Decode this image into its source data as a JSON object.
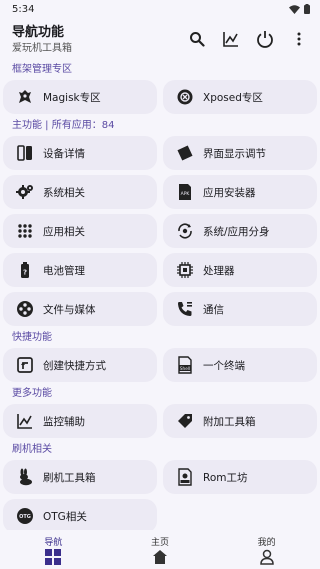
{
  "status": {
    "time": "5:34"
  },
  "app": {
    "title": "导航功能",
    "subtitle": "爱玩机工具箱"
  },
  "sections": [
    {
      "title": "框架管理专区",
      "items": [
        {
          "label": "Magisk专区",
          "icon": "magisk-icon"
        },
        {
          "label": "Xposed专区",
          "icon": "xposed-icon"
        }
      ]
    },
    {
      "title": "主功能 | 所有应用：84",
      "items": [
        {
          "label": "设备详情",
          "icon": "device-icon"
        },
        {
          "label": "界面显示调节",
          "icon": "display-icon"
        },
        {
          "label": "系统相关",
          "icon": "gear-icon"
        },
        {
          "label": "应用安装器",
          "icon": "apk-icon"
        },
        {
          "label": "应用相关",
          "icon": "apps-grid-icon"
        },
        {
          "label": "系统/应用分身",
          "icon": "clone-icon"
        },
        {
          "label": "电池管理",
          "icon": "battery-icon"
        },
        {
          "label": "处理器",
          "icon": "cpu-icon"
        },
        {
          "label": "文件与媒体",
          "icon": "media-icon"
        },
        {
          "label": "通信",
          "icon": "phone-icon"
        }
      ]
    },
    {
      "title": "快捷功能",
      "items": [
        {
          "label": "创建快捷方式",
          "icon": "shortcut-icon"
        },
        {
          "label": "一个终端",
          "icon": "shell-icon"
        }
      ]
    },
    {
      "title": "更多功能",
      "items": [
        {
          "label": "监控辅助",
          "icon": "monitor-icon"
        },
        {
          "label": "附加工具箱",
          "icon": "tag-icon"
        }
      ]
    },
    {
      "title": "刷机相关",
      "items": [
        {
          "label": "刷机工具箱",
          "icon": "rabbit-icon"
        },
        {
          "label": "Rom工坊",
          "icon": "rom-file-icon"
        },
        {
          "label": "OTG相关",
          "icon": "otg-icon"
        }
      ]
    }
  ],
  "nav": [
    {
      "label": "导航",
      "icon": "grid-nav-icon",
      "active": true
    },
    {
      "label": "主页",
      "icon": "home-icon",
      "active": false
    },
    {
      "label": "我的",
      "icon": "person-icon",
      "active": false
    }
  ],
  "colors": {
    "background": "#f6f5fb",
    "card": "#eceaf4",
    "section": "#5a4aa3",
    "accent": "#3a2e8c"
  }
}
